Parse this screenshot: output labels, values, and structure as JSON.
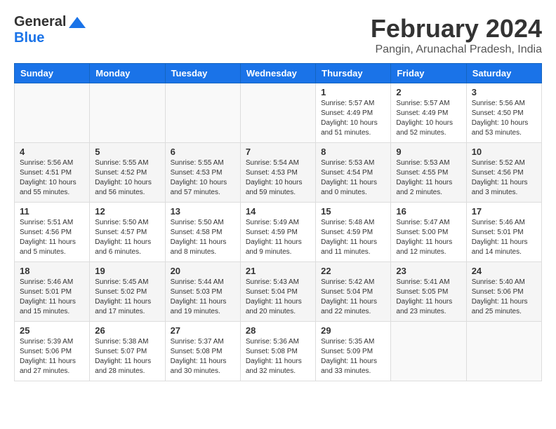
{
  "header": {
    "logo_general": "General",
    "logo_blue": "Blue",
    "month_year": "February 2024",
    "location": "Pangin, Arunachal Pradesh, India"
  },
  "weekdays": [
    "Sunday",
    "Monday",
    "Tuesday",
    "Wednesday",
    "Thursday",
    "Friday",
    "Saturday"
  ],
  "weeks": [
    [
      {
        "day": "",
        "info": ""
      },
      {
        "day": "",
        "info": ""
      },
      {
        "day": "",
        "info": ""
      },
      {
        "day": "",
        "info": ""
      },
      {
        "day": "1",
        "info": "Sunrise: 5:57 AM\nSunset: 4:49 PM\nDaylight: 10 hours and 51 minutes."
      },
      {
        "day": "2",
        "info": "Sunrise: 5:57 AM\nSunset: 4:49 PM\nDaylight: 10 hours and 52 minutes."
      },
      {
        "day": "3",
        "info": "Sunrise: 5:56 AM\nSunset: 4:50 PM\nDaylight: 10 hours and 53 minutes."
      }
    ],
    [
      {
        "day": "4",
        "info": "Sunrise: 5:56 AM\nSunset: 4:51 PM\nDaylight: 10 hours and 55 minutes."
      },
      {
        "day": "5",
        "info": "Sunrise: 5:55 AM\nSunset: 4:52 PM\nDaylight: 10 hours and 56 minutes."
      },
      {
        "day": "6",
        "info": "Sunrise: 5:55 AM\nSunset: 4:53 PM\nDaylight: 10 hours and 57 minutes."
      },
      {
        "day": "7",
        "info": "Sunrise: 5:54 AM\nSunset: 4:53 PM\nDaylight: 10 hours and 59 minutes."
      },
      {
        "day": "8",
        "info": "Sunrise: 5:53 AM\nSunset: 4:54 PM\nDaylight: 11 hours and 0 minutes."
      },
      {
        "day": "9",
        "info": "Sunrise: 5:53 AM\nSunset: 4:55 PM\nDaylight: 11 hours and 2 minutes."
      },
      {
        "day": "10",
        "info": "Sunrise: 5:52 AM\nSunset: 4:56 PM\nDaylight: 11 hours and 3 minutes."
      }
    ],
    [
      {
        "day": "11",
        "info": "Sunrise: 5:51 AM\nSunset: 4:56 PM\nDaylight: 11 hours and 5 minutes."
      },
      {
        "day": "12",
        "info": "Sunrise: 5:50 AM\nSunset: 4:57 PM\nDaylight: 11 hours and 6 minutes."
      },
      {
        "day": "13",
        "info": "Sunrise: 5:50 AM\nSunset: 4:58 PM\nDaylight: 11 hours and 8 minutes."
      },
      {
        "day": "14",
        "info": "Sunrise: 5:49 AM\nSunset: 4:59 PM\nDaylight: 11 hours and 9 minutes."
      },
      {
        "day": "15",
        "info": "Sunrise: 5:48 AM\nSunset: 4:59 PM\nDaylight: 11 hours and 11 minutes."
      },
      {
        "day": "16",
        "info": "Sunrise: 5:47 AM\nSunset: 5:00 PM\nDaylight: 11 hours and 12 minutes."
      },
      {
        "day": "17",
        "info": "Sunrise: 5:46 AM\nSunset: 5:01 PM\nDaylight: 11 hours and 14 minutes."
      }
    ],
    [
      {
        "day": "18",
        "info": "Sunrise: 5:46 AM\nSunset: 5:01 PM\nDaylight: 11 hours and 15 minutes."
      },
      {
        "day": "19",
        "info": "Sunrise: 5:45 AM\nSunset: 5:02 PM\nDaylight: 11 hours and 17 minutes."
      },
      {
        "day": "20",
        "info": "Sunrise: 5:44 AM\nSunset: 5:03 PM\nDaylight: 11 hours and 19 minutes."
      },
      {
        "day": "21",
        "info": "Sunrise: 5:43 AM\nSunset: 5:04 PM\nDaylight: 11 hours and 20 minutes."
      },
      {
        "day": "22",
        "info": "Sunrise: 5:42 AM\nSunset: 5:04 PM\nDaylight: 11 hours and 22 minutes."
      },
      {
        "day": "23",
        "info": "Sunrise: 5:41 AM\nSunset: 5:05 PM\nDaylight: 11 hours and 23 minutes."
      },
      {
        "day": "24",
        "info": "Sunrise: 5:40 AM\nSunset: 5:06 PM\nDaylight: 11 hours and 25 minutes."
      }
    ],
    [
      {
        "day": "25",
        "info": "Sunrise: 5:39 AM\nSunset: 5:06 PM\nDaylight: 11 hours and 27 minutes."
      },
      {
        "day": "26",
        "info": "Sunrise: 5:38 AM\nSunset: 5:07 PM\nDaylight: 11 hours and 28 minutes."
      },
      {
        "day": "27",
        "info": "Sunrise: 5:37 AM\nSunset: 5:08 PM\nDaylight: 11 hours and 30 minutes."
      },
      {
        "day": "28",
        "info": "Sunrise: 5:36 AM\nSunset: 5:08 PM\nDaylight: 11 hours and 32 minutes."
      },
      {
        "day": "29",
        "info": "Sunrise: 5:35 AM\nSunset: 5:09 PM\nDaylight: 11 hours and 33 minutes."
      },
      {
        "day": "",
        "info": ""
      },
      {
        "day": "",
        "info": ""
      }
    ]
  ]
}
